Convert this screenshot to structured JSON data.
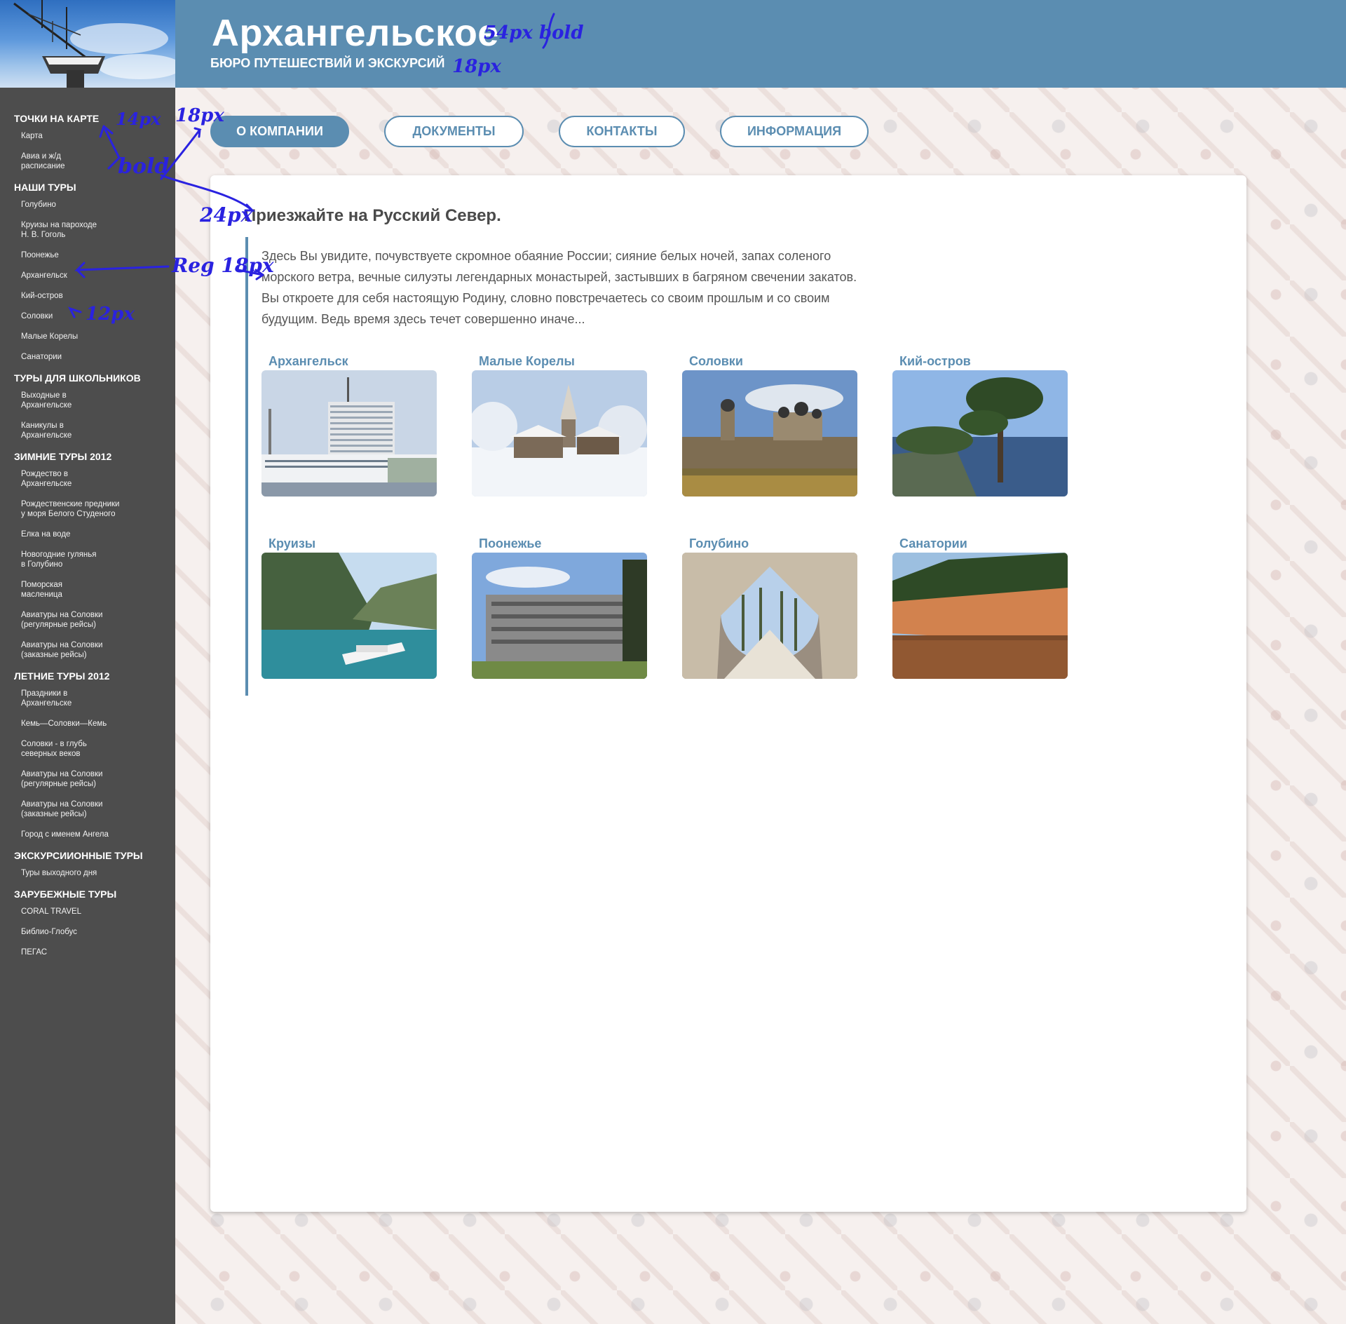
{
  "header": {
    "title": "Архангельское",
    "subtitle": "БЮРО ПУТЕШЕСТВИЙ И ЭКСКУРСИЙ"
  },
  "sidebar": {
    "sections": [
      {
        "heading": "ТОЧКИ НА КАРТЕ",
        "items": [
          "Карта",
          "Авиа и ж/д\nрасписание"
        ]
      },
      {
        "heading": "НАШИ ТУРЫ",
        "items": [
          "Голубино",
          "Круизы на пароходе\nН. В. Гоголь",
          "Поонежье",
          "Архангельск",
          "Кий-остров",
          "Соловки",
          "Малые Корелы",
          "Санатории"
        ]
      },
      {
        "heading": "ТУРЫ ДЛЯ ШКОЛЬНИКОВ",
        "items": [
          "Выходные в\nАрхангельске",
          "Каникулы в\nАрхангельске"
        ]
      },
      {
        "heading": "ЗИМНИЕ ТУРЫ 2012",
        "items": [
          "Рождество в\nАрхангельске",
          "Рождественские предники\nу моря Белого Студеного",
          "Елка на воде",
          "Новогодние гулянья\nв Голубино",
          "Поморская\nмасленица",
          "Авиатуры на Соловки\n(регулярные рейсы)",
          "Авиатуры на Соловки\n(заказные рейсы)"
        ]
      },
      {
        "heading": "ЛЕТНИЕ ТУРЫ 2012",
        "items": [
          "Праздники в\nАрхангельске",
          "Кемь—Соловки—Кемь",
          "Соловки - в глубь\nсеверных веков",
          "Авиатуры на Соловки\n(регулярные рейсы)",
          "Авиатуры на Соловки\n(заказные рейсы)",
          "Город с именем Ангела"
        ]
      },
      {
        "heading": "ЭКСКУРСИИОННЫЕ ТУРЫ",
        "items": [
          "Туры выходного дня"
        ]
      },
      {
        "heading": "ЗАРУБЕЖНЫЕ ТУРЫ",
        "items": [
          "CORAL TRAVEL",
          "Библио-Глобус",
          "ПЕГАС"
        ]
      }
    ]
  },
  "nav": {
    "tabs": [
      {
        "label": "О КОМПАНИИ",
        "active": true
      },
      {
        "label": "ДОКУМЕНТЫ",
        "active": false
      },
      {
        "label": "КОНТАКТЫ",
        "active": false
      },
      {
        "label": "ИНФОРМАЦИЯ",
        "active": false
      }
    ]
  },
  "main": {
    "title": "Приезжайте на  Русский Север.",
    "intro": "Здесь Вы увидите, почувствуете скромное обаяние России; сияние белых ночей, запах соленого морского ветра, вечные силуэты легендарных монастырей, застывших в багряном свечении закатов. Вы откроете для себя настоящую Родину, словно повстречаетесь со своим прошлым и со своим будущим. Ведь время здесь течет совершенно иначе...",
    "tiles": [
      {
        "label": "Архангельск",
        "photo": "city-port-photo"
      },
      {
        "label": "Малые Корелы",
        "photo": "winter-village-photo"
      },
      {
        "label": "Соловки",
        "photo": "monastery-photo"
      },
      {
        "label": "Кий-остров",
        "photo": "island-pine-photo"
      },
      {
        "label": "Круизы",
        "photo": "cruise-ship-photo"
      },
      {
        "label": "Поонежье",
        "photo": "sanatorium-building-photo"
      },
      {
        "label": "Голубино",
        "photo": "cave-photo"
      },
      {
        "label": "Санатории",
        "photo": "cliff-river-photo"
      }
    ]
  },
  "annotations": {
    "title_size": "54px bold",
    "subtitle_size": "18px",
    "sidebar_heading_size": "14px",
    "sidebar_heading_weight": "bold",
    "nav_size": "18px",
    "heading_size": "24px",
    "intro_size": "Reg 18px",
    "sidebar_item_size": "12px"
  },
  "colors": {
    "accent": "#5b8db1",
    "sidebar_bg": "#4d4d4d",
    "annotation": "#2a22e0"
  }
}
